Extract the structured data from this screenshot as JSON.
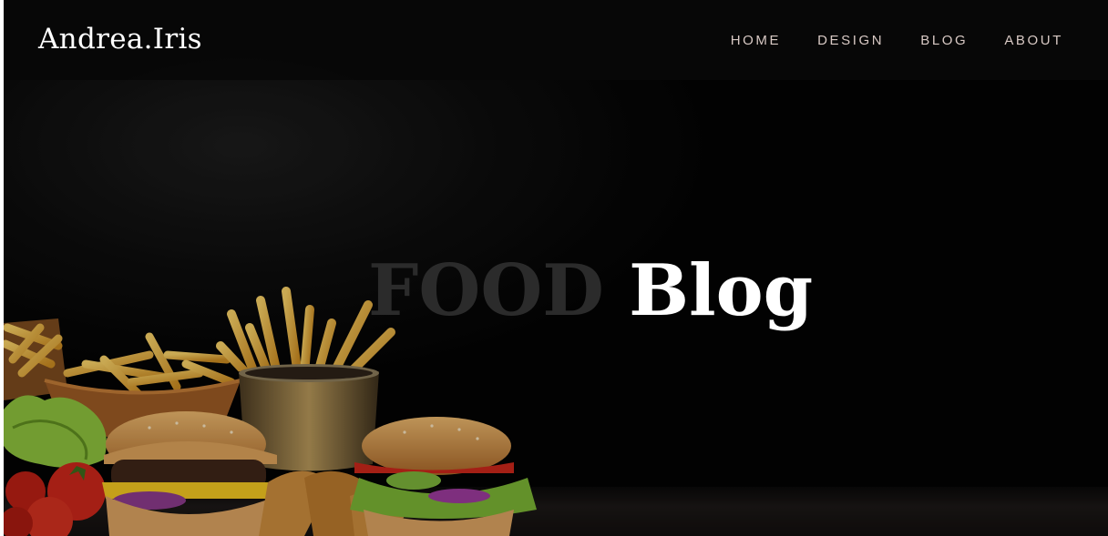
{
  "header": {
    "logo": "Andrea.Iris",
    "nav": [
      {
        "label": "HOME"
      },
      {
        "label": "DESIGN"
      },
      {
        "label": "BLOG"
      },
      {
        "label": "ABOUT"
      }
    ]
  },
  "hero": {
    "title_faded": "FOOD",
    "title_bright": "Blog"
  },
  "colors": {
    "background": "#000000",
    "nav_text": "#d8c9c4",
    "title_bright": "#ffffff",
    "title_faded": "#2b2b2b"
  }
}
